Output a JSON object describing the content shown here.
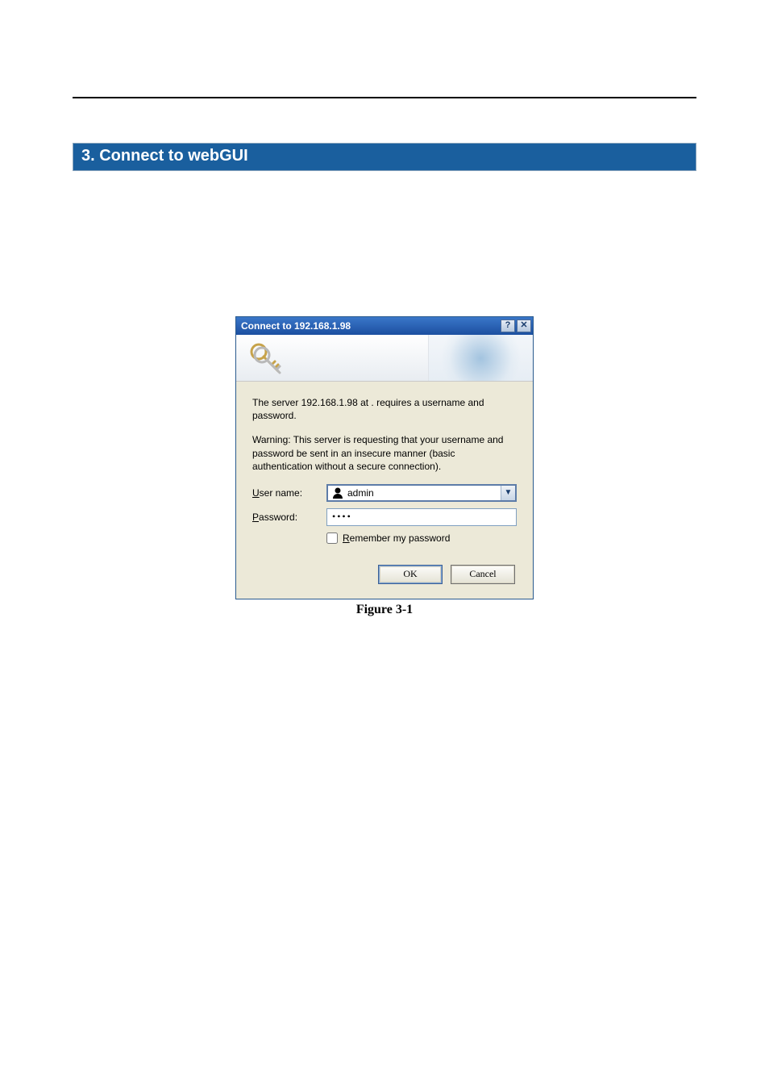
{
  "section_heading": "3. Connect to webGUI",
  "dialog": {
    "title": "Connect to 192.168.1.98",
    "msg1": "The server 192.168.1.98 at . requires a username and password.",
    "msg2": "Warning: This server is requesting that your username and password be sent in an insecure manner (basic authentication without a secure connection).",
    "username_label_pre": "U",
    "username_label_rest": "ser name:",
    "password_label_pre": "P",
    "password_label_rest": "assword:",
    "username_value": "admin",
    "password_value": "••••",
    "remember_pre": "R",
    "remember_rest": "emember my password",
    "ok_label": "OK",
    "cancel_label": "Cancel",
    "help_glyph": "?",
    "close_glyph": "✕"
  },
  "figure_caption": "Figure 3-1"
}
